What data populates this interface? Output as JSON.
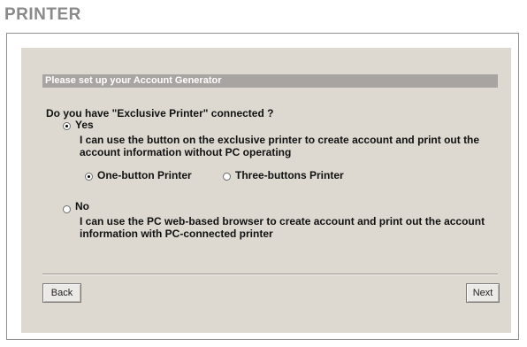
{
  "page": {
    "title": "PRINTER"
  },
  "section": {
    "header": "Please set up your Account Generator"
  },
  "form": {
    "question": "Do you have \"Exclusive Printer\" connected ?",
    "yes": {
      "label": "Yes",
      "selected": true,
      "description": "I can use the button on the exclusive printer to create account and print out the account information without PC operating",
      "printer_types": [
        {
          "label": "One-button Printer",
          "selected": true
        },
        {
          "label": "Three-buttons Printer",
          "selected": false
        }
      ]
    },
    "no": {
      "label": "No",
      "selected": false,
      "description": "I can use the PC web-based browser to create account and print out the account information with PC-connected printer"
    }
  },
  "buttons": {
    "back": "Back",
    "next": "Next"
  }
}
